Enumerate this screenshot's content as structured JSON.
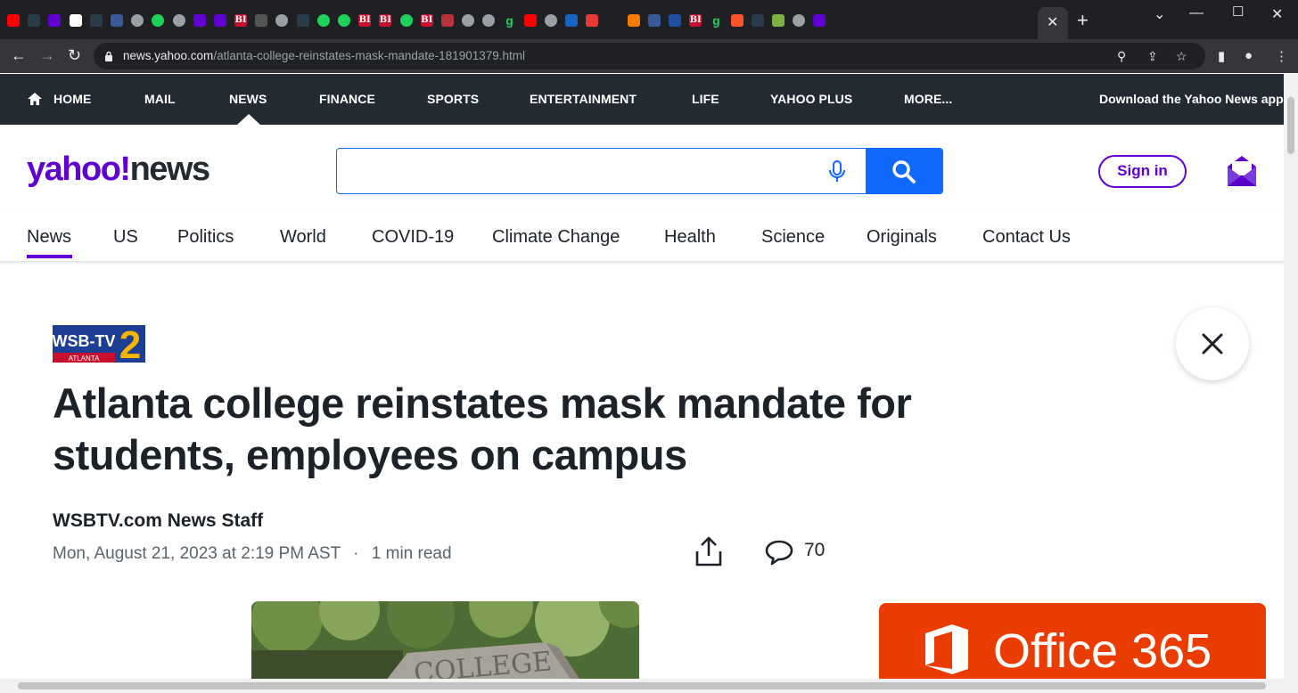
{
  "browser": {
    "url_host": "news.yahoo.com",
    "url_path": "/atlanta-college-reinstates-mask-mandate-181901379.html",
    "tab_icons": [
      {
        "name": "youtube-favicon",
        "bg": "#ff0000",
        "text": ""
      },
      {
        "name": "shield-favicon",
        "bg": "#2a3b4a",
        "text": ""
      },
      {
        "name": "mail-favicon",
        "bg": "#6001d2",
        "text": ""
      },
      {
        "name": "notion-favicon",
        "bg": "#ffffff",
        "text": ""
      },
      {
        "name": "shield-favicon",
        "bg": "#2a3b4a",
        "text": ""
      },
      {
        "name": "arrow-favicon",
        "bg": "#3b5998",
        "text": ""
      },
      {
        "name": "globe-favicon",
        "bg": "#9aa0a6",
        "text": ""
      },
      {
        "name": "play-favicon",
        "bg": "#1fd15b",
        "text": ""
      },
      {
        "name": "globe-favicon",
        "bg": "#9aa0a6",
        "text": ""
      },
      {
        "name": "yahoo-favicon",
        "bg": "#6001d2",
        "text": ""
      },
      {
        "name": "yahoo-favicon",
        "bg": "#6001d2",
        "text": ""
      },
      {
        "name": "bi-favicon",
        "bg": "#c8102e",
        "text": "BI"
      },
      {
        "name": "slash-favicon",
        "bg": "#555555",
        "text": ""
      },
      {
        "name": "globe-favicon",
        "bg": "#9aa0a6",
        "text": ""
      },
      {
        "name": "shield-favicon",
        "bg": "#2a3b4a",
        "text": ""
      },
      {
        "name": "play-favicon",
        "bg": "#1fd15b",
        "text": ""
      },
      {
        "name": "play-favicon",
        "bg": "#1fd15b",
        "text": ""
      },
      {
        "name": "bi-favicon",
        "bg": "#c8102e",
        "text": "BI"
      },
      {
        "name": "bi-favicon",
        "bg": "#c8102e",
        "text": "BI"
      },
      {
        "name": "play-favicon",
        "bg": "#1fd15b",
        "text": ""
      },
      {
        "name": "bi-favicon",
        "bg": "#c8102e",
        "text": "BI"
      },
      {
        "name": "burst-favicon",
        "bg": "#b8323a",
        "text": ""
      },
      {
        "name": "globe-favicon",
        "bg": "#9aa0a6",
        "text": ""
      },
      {
        "name": "globe-favicon",
        "bg": "#9aa0a6",
        "text": ""
      },
      {
        "name": "g-favicon",
        "bg": "#1f2023",
        "text": "g"
      },
      {
        "name": "youtube-favicon",
        "bg": "#ff0000",
        "text": ""
      },
      {
        "name": "globe-favicon",
        "bg": "#9aa0a6",
        "text": ""
      },
      {
        "name": "dr-favicon",
        "bg": "#1565c0",
        "text": ""
      },
      {
        "name": "mic-favicon",
        "bg": "#e53935",
        "text": ""
      },
      {
        "name": "search-favicon",
        "bg": "#1f2023",
        "text": ""
      },
      {
        "name": "bars-favicon",
        "bg": "#f57c00",
        "text": ""
      },
      {
        "name": "arrow-favicon",
        "bg": "#3b5998",
        "text": ""
      },
      {
        "name": "hex-favicon",
        "bg": "#1e4fa0",
        "text": ""
      },
      {
        "name": "bi-favicon",
        "bg": "#c8102e",
        "text": "BI"
      },
      {
        "name": "g-favicon",
        "bg": "#1f2023",
        "text": "g"
      },
      {
        "name": "brave-favicon",
        "bg": "#fb542b",
        "text": ""
      },
      {
        "name": "shield-favicon",
        "bg": "#2a3b4a",
        "text": ""
      },
      {
        "name": "grid-favicon",
        "bg": "#7cb342",
        "text": ""
      },
      {
        "name": "globe-favicon",
        "bg": "#9aa0a6",
        "text": ""
      },
      {
        "name": "yahoo-favicon",
        "bg": "#6001d2",
        "text": ""
      }
    ]
  },
  "topnav": {
    "items": [
      "HOME",
      "MAIL",
      "NEWS",
      "FINANCE",
      "SPORTS",
      "ENTERTAINMENT",
      "LIFE",
      "YAHOO PLUS",
      "MORE..."
    ],
    "download": "Download the Yahoo News app"
  },
  "header": {
    "logo_yahoo": "yahoo!",
    "logo_news": "news",
    "search_placeholder": "",
    "signin": "Sign in"
  },
  "subnav": {
    "items": [
      "News",
      "US",
      "Politics",
      "World",
      "COVID-19",
      "Climate Change",
      "Health",
      "Science",
      "Originals",
      "Contact Us"
    ],
    "active": "News"
  },
  "article": {
    "source_logo_text": "WSB-TV",
    "source_logo_sub": "ATLANTA",
    "source_logo_num": "2",
    "headline": "Atlanta college reinstates mask mandate for students, employees on campus",
    "author": "WSBTV.com News Staff",
    "date": "Mon, August 21, 2023 at 2:19 PM AST",
    "sep": "·",
    "read_time": "1 min read",
    "comment_count": "70",
    "photo_text": "COLLEGE"
  },
  "ad": {
    "text": "Office 365"
  },
  "colors": {
    "yahoo_purple": "#6001d2",
    "search_blue": "#0f69ff",
    "nav_dark": "#232a31",
    "ad_orange": "#eb3c00"
  }
}
